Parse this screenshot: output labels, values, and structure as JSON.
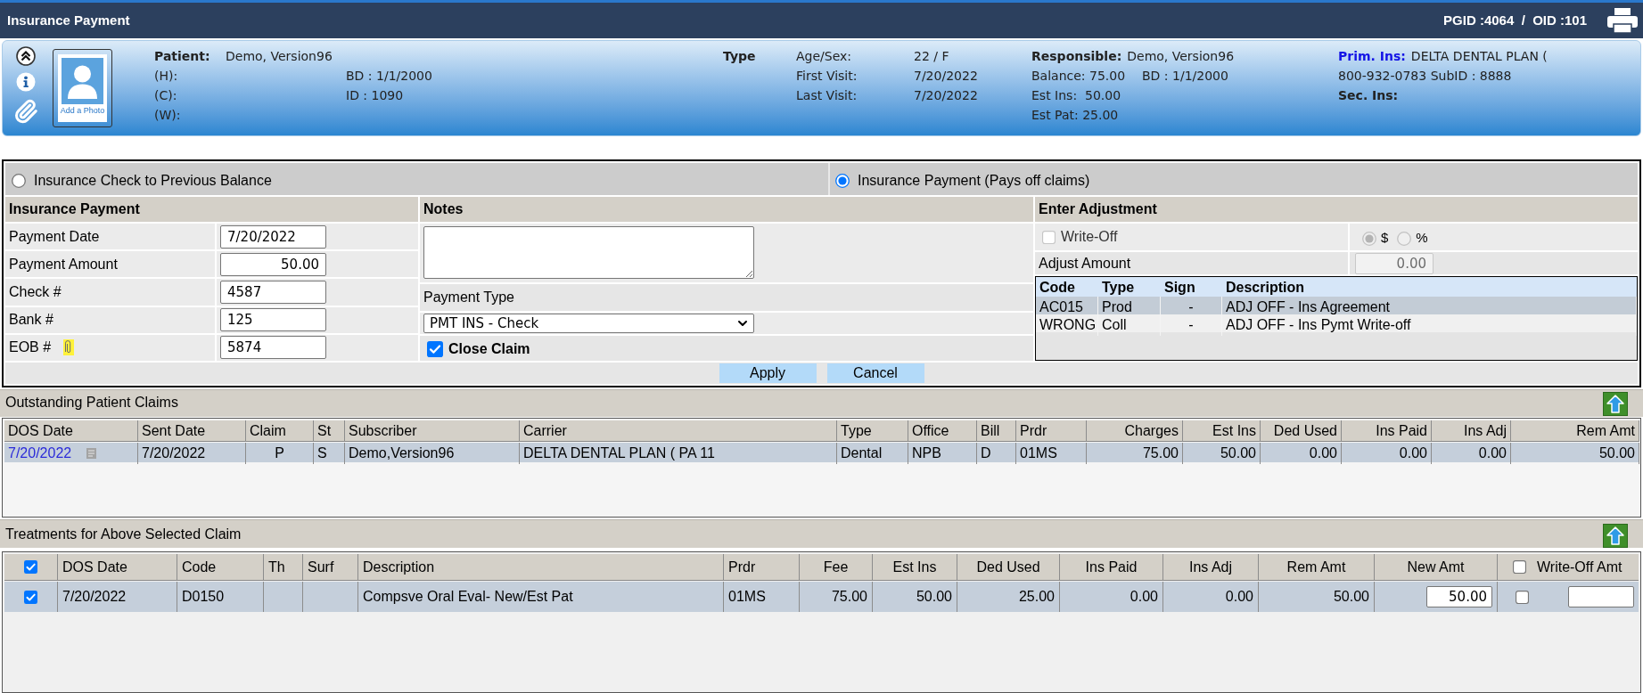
{
  "title_bar": {
    "title": "Insurance Payment",
    "ids": "PGID :4064  /  OID :101"
  },
  "patient_header": {
    "photo_caption": "Add a Photo",
    "patient": {
      "label": "Patient:",
      "value": "Demo, Version96"
    },
    "phones": [
      "(H):",
      "(C):",
      "(W):"
    ],
    "birth_date": "BD : 1/1/2000",
    "patient_id": "ID : 1090",
    "type_label": "Type",
    "details": [
      {
        "label": "Age/Sex:",
        "value": "22 / F"
      },
      {
        "label": "First Visit:",
        "value": "7/20/2022"
      },
      {
        "label": "Last Visit:",
        "value": "7/20/2022"
      }
    ],
    "responsible": {
      "label": "Responsible:",
      "value": "Demo, Version96"
    },
    "balance": "Balance: 75.00",
    "responsible_birth_date": "BD : 1/1/2000",
    "est_ins": "Est Ins:  50.00",
    "est_pat": "Est Pat: 25.00",
    "primary_insurance": {
      "label": "Prim. Ins:",
      "value": "DELTA DENTAL PLAN ("
    },
    "insurance_phone": "800-932-0783 SubID : 8888",
    "secondary_insurance_label": "Sec. Ins:"
  },
  "payment_modes": [
    {
      "label": "Insurance Check to Previous Balance",
      "selected": false
    },
    {
      "label": "Insurance Payment (Pays off claims)",
      "selected": true
    }
  ],
  "insurance_payment": {
    "heading": "Insurance Payment",
    "fields": [
      {
        "label": "Payment Date",
        "value": "7/20/2022",
        "kind": "text",
        "attachment": false
      },
      {
        "label": "Payment Amount",
        "value": "50.00",
        "kind": "amount",
        "attachment": false
      },
      {
        "label": "Check #",
        "value": "4587",
        "kind": "text",
        "attachment": false
      },
      {
        "label": "Bank #",
        "value": "125",
        "kind": "text",
        "attachment": false
      },
      {
        "label": "EOB #",
        "value": "5874",
        "kind": "text",
        "attachment": true
      }
    ]
  },
  "notes": {
    "heading": "Notes",
    "payment_type_label": "Payment Type",
    "payment_type": "PMT INS - Check",
    "close_claim": {
      "label": "Close Claim",
      "checked": true
    }
  },
  "adjustment": {
    "heading": "Enter Adjustment",
    "write_off": {
      "label": "Write-Off",
      "checked": false,
      "disabled": true
    },
    "units": [
      {
        "label": "$",
        "selected": true,
        "disabled": true
      },
      {
        "label": "%",
        "selected": false,
        "disabled": true
      }
    ],
    "adjust_amount_label": "Adjust Amount",
    "adjust_amount": {
      "value": "0.00",
      "disabled": true
    },
    "codes": {
      "columns": [
        "Code",
        "Type",
        "Sign",
        "Description"
      ],
      "rows": [
        {
          "cells": [
            "AC015",
            "Prod",
            "-",
            "ADJ OFF - Ins Agreement"
          ],
          "selected": true
        },
        {
          "cells": [
            "WRONG",
            "Coll",
            "-",
            "ADJ OFF - Ins Pymt Write-off"
          ],
          "selected": false
        }
      ]
    }
  },
  "buttons": [
    "Apply",
    "Cancel"
  ],
  "outstanding_claims": {
    "title": "Outstanding Patient Claims",
    "columns": [
      "DOS Date",
      "Sent Date",
      "Claim",
      "St",
      "Subscriber",
      "Carrier",
      "Type",
      "Office",
      "Bill",
      "Prdr",
      "Charges",
      "Est Ins",
      "Ded Used",
      "Ins Paid",
      "Ins Adj",
      "Rem Amt"
    ],
    "rows": [
      {
        "selected": true,
        "cells": [
          "7/20/2022",
          "7/20/2022",
          "P",
          "S",
          "Demo,Version96",
          "DELTA DENTAL PLAN ( PA 11",
          "Dental",
          "NPB",
          "D",
          "01MS",
          "75.00",
          "50.00",
          "0.00",
          "0.00",
          "0.00",
          "50.00"
        ]
      }
    ]
  },
  "treatments": {
    "title": "Treatments for Above Selected Claim",
    "select_all": true,
    "write_off_all": false,
    "columns": [
      "DOS Date",
      "Code",
      "Th",
      "Surf",
      "Description",
      "Prdr",
      "Fee",
      "Est Ins",
      "Ded Used",
      "Ins Paid",
      "Ins Adj",
      "Rem Amt",
      "New Amt",
      "Write-Off Amt"
    ],
    "rows": [
      {
        "checked": true,
        "dos_date": "7/20/2022",
        "code": "D0150",
        "description": "Compsve Oral Eval- New/Est Pat",
        "prdr": "01MS",
        "fee": "75.00",
        "est_ins": "50.00",
        "ded_used": "25.00",
        "ins_paid": "0.00",
        "ins_adj": "0.00",
        "rem_amt": "50.00",
        "new_amt": "50.00",
        "write_off": false
      }
    ]
  }
}
